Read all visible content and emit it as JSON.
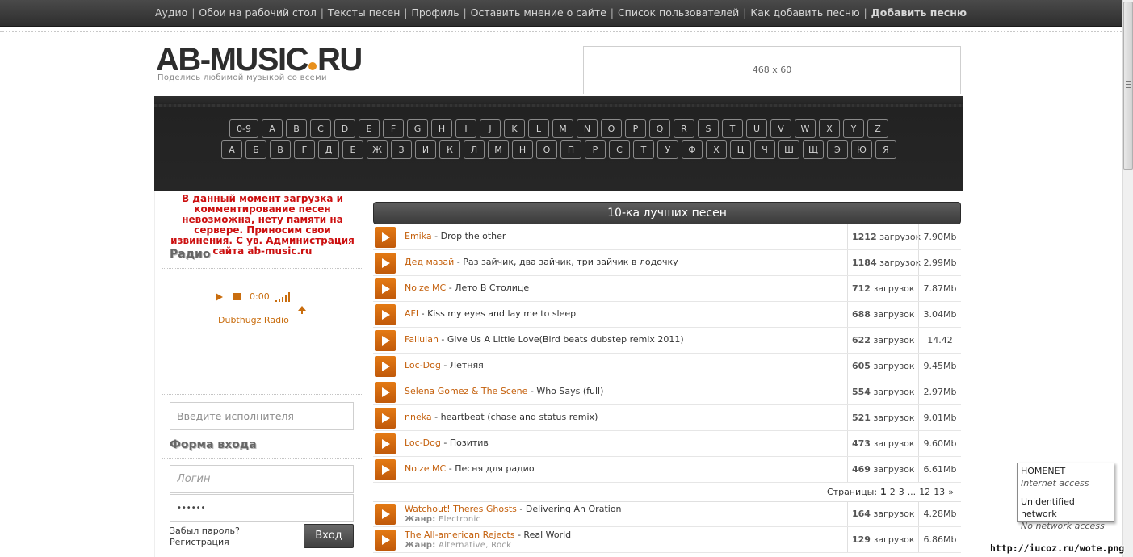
{
  "nav": {
    "items": [
      {
        "label": "Аудио",
        "bold": false
      },
      {
        "label": "Обои на рабочий стол",
        "bold": false
      },
      {
        "label": "Тексты песен",
        "bold": false
      },
      {
        "label": "Профиль",
        "bold": false
      },
      {
        "label": "Оставить мнение о сайте",
        "bold": false
      },
      {
        "label": "Список пользователей",
        "bold": false
      },
      {
        "label": "Как добавить песню",
        "bold": false
      },
      {
        "label": "Добавить песню",
        "bold": true
      }
    ],
    "separator": "|"
  },
  "header": {
    "logo_left": "AB-MUSIC",
    "logo_right": "RU",
    "tagline": "Поделись любимой музыкой со всеми",
    "banner": "468 x 60"
  },
  "alphabet": {
    "latin": [
      "0-9",
      "A",
      "B",
      "C",
      "D",
      "E",
      "F",
      "G",
      "H",
      "I",
      "J",
      "K",
      "L",
      "M",
      "N",
      "O",
      "P",
      "Q",
      "R",
      "S",
      "T",
      "U",
      "V",
      "W",
      "X",
      "Y",
      "Z"
    ],
    "cyrillic": [
      "А",
      "Б",
      "В",
      "Г",
      "Д",
      "Е",
      "Ж",
      "З",
      "И",
      "К",
      "Л",
      "М",
      "Н",
      "О",
      "П",
      "Р",
      "С",
      "Т",
      "У",
      "Ф",
      "Х",
      "Ц",
      "Ч",
      "Ш",
      "Щ",
      "Э",
      "Ю",
      "Я"
    ]
  },
  "sidebar": {
    "notice": "В данный момент загрузка и комментирование песен невозможна, нету памяти на сервере. Приносим свои извинения. С ув. Администрация сайта ab-music.ru",
    "radio_title": "Радио",
    "player_time": "0:00",
    "station": "Dubthugz Radio",
    "search_placeholder": "Введите исполнителя",
    "login_title": "Форма входа",
    "login_placeholder": "Логин",
    "password_value": "••••••",
    "forgot": "Забыл пароль?",
    "register": "Регистрация",
    "login_button": "Вход"
  },
  "main": {
    "title": "10-ка лучших песен",
    "downloads_word": "загрузок",
    "top10": [
      {
        "artist": "Emika",
        "title": "Drop the other",
        "count": "1212",
        "size": "7.90Mb"
      },
      {
        "artist": "Дед мазай",
        "title": "Раз зайчик, два зайчик, три зайчик в лодочку",
        "count": "1184",
        "size": "2.99Mb"
      },
      {
        "artist": "Noize MC",
        "title": "Лето В Столице",
        "count": "712",
        "size": "7.87Mb"
      },
      {
        "artist": "AFI",
        "title": "Kiss my eyes and lay me to sleep",
        "count": "688",
        "size": "3.04Mb"
      },
      {
        "artist": "Fallulah",
        "title": "Give Us A Little Love(Bird beats dubstep remix 2011)",
        "count": "622",
        "size": "14.42"
      },
      {
        "artist": "Loc-Dog",
        "title": "Летняя",
        "count": "605",
        "size": "9.45Mb"
      },
      {
        "artist": "Selena Gomez & The Scene",
        "title": "Who Says (full)",
        "count": "554",
        "size": "2.97Mb"
      },
      {
        "artist": "nneka",
        "title": "heartbeat (chase and status remix)",
        "count": "521",
        "size": "9.01Mb"
      },
      {
        "artist": "Loc-Dog",
        "title": "Позитив",
        "count": "473",
        "size": "9.60Mb"
      },
      {
        "artist": "Noize MC",
        "title": "Песня для радио",
        "count": "469",
        "size": "6.61Mb"
      }
    ],
    "pages_label": "Страницы:",
    "pages": [
      "1",
      "2",
      "3",
      "...",
      "12",
      "13",
      "»"
    ],
    "recent": [
      {
        "artist": "Watchout! Theres Ghosts",
        "title": "Delivering An Oration",
        "genre_label": "Жанр:",
        "genre": "Electronic",
        "count": "164",
        "size": "4.28Mb"
      },
      {
        "artist": "The All-american Rejects",
        "title": "Real World",
        "genre_label": "Жанр:",
        "genre": "Alternative, Rock",
        "count": "129",
        "size": "6.86Mb"
      }
    ]
  },
  "network": {
    "name1": "HOMENET",
    "status1": "Internet access",
    "name2": "Unidentified network",
    "status2": "No network access"
  },
  "watermark": "http://iucoz.ru/wote.png",
  "colors": {
    "accent": "#c45f0b",
    "play_button": "#d86c10",
    "notice": "#cc1010",
    "dark_panel": "#242424"
  }
}
